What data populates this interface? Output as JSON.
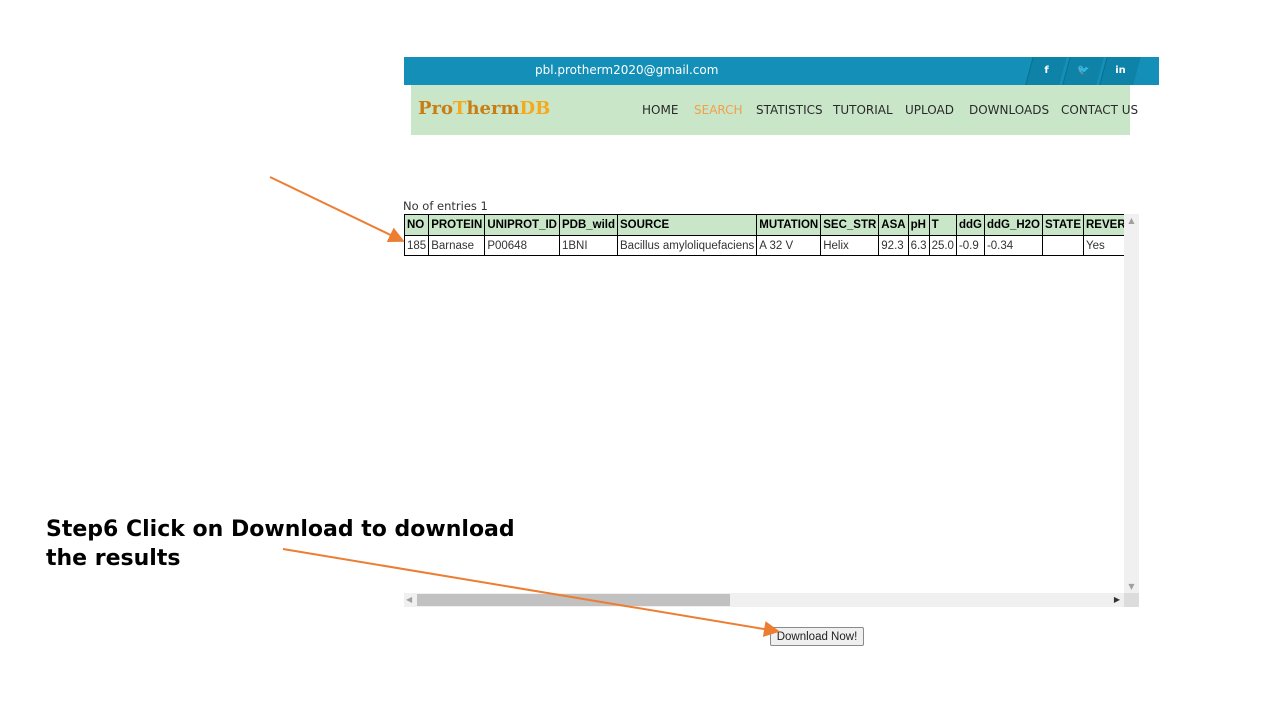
{
  "topbar": {
    "email": "pbl.protherm2020@gmail.com",
    "social": [
      {
        "icon": "facebook-icon",
        "glyph": "f"
      },
      {
        "icon": "twitter-icon",
        "glyph": "🐦"
      },
      {
        "icon": "linkedin-icon",
        "glyph": "in"
      }
    ]
  },
  "logo": {
    "part1": "Pro",
    "part2": "T",
    "part3": "herm",
    "part4": "DB"
  },
  "nav": {
    "items": [
      "HOME",
      "SEARCH",
      "STATISTICS",
      "TUTORIAL",
      "UPLOAD",
      "DOWNLOADS",
      "CONTACT US"
    ],
    "active": "SEARCH"
  },
  "results": {
    "entries_label": "No of entries 1",
    "columns": [
      "NO",
      "PROTEIN",
      "UNIPROT_ID",
      "PDB_wild",
      "SOURCE",
      "MUTATION",
      "SEC_STR",
      "ASA",
      "pH",
      "T",
      "ddG",
      "ddG_H2O",
      "STATE",
      "REVERSIBILITY"
    ],
    "rows": [
      [
        "185",
        "Barnase",
        "P00648",
        "1BNI",
        "Bacillus amyloliquefaciens",
        "A 32 V",
        "Helix",
        "92.3",
        "6.3",
        "25.0",
        "-0.9",
        "-0.34",
        "",
        "Yes"
      ]
    ]
  },
  "download_button": "Download Now!",
  "instruction": {
    "line1": "Step6 Click on Download to download",
    "line2": "the results"
  },
  "colors": {
    "topbar": "#138fb8",
    "navbar": "#c9e6c9",
    "arrow": "#ed7d31",
    "active_nav": "#f0a04a"
  }
}
